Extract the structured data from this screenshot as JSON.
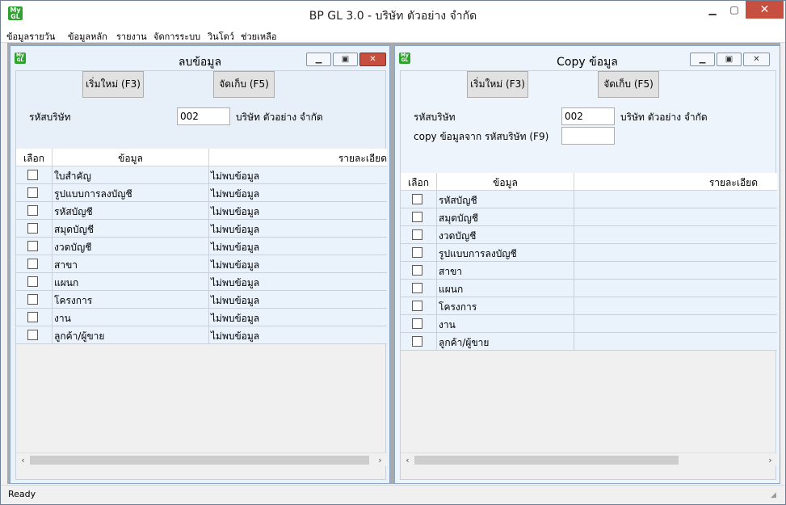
{
  "app": {
    "logo_top": "My",
    "logo_bottom": "GL",
    "title": "BP GL 3.0 - บริษัท ตัวอย่าง จำกัด",
    "min_icon": "minimize-icon",
    "max_icon": "maximize-icon",
    "close_icon": "close-icon"
  },
  "menu": [
    "ข้อมูลรายวัน",
    "ข้อมูลหลัก",
    "รายงาน",
    "จัดการระบบ",
    "วินโดว์",
    "ช่วยเหลือ"
  ],
  "left": {
    "title": "ลบข้อมูล",
    "new_button": "เริ่มใหม่ (F3)",
    "save_button": "จัดเก็บ (F5)",
    "company_label": "รหัสบริษัท",
    "company_code": "002",
    "company_name": "บริษัท ตัวอย่าง จำกัด",
    "headers": [
      "เลือก",
      "ข้อมูล",
      "รายละเอียด"
    ],
    "rows": [
      {
        "name": "ใบสำคัญ",
        "detail": "ไม่พบข้อมูล"
      },
      {
        "name": "รูปแบบการลงบัญชี",
        "detail": "ไม่พบข้อมูล"
      },
      {
        "name": "รหัสบัญชี",
        "detail": "ไม่พบข้อมูล"
      },
      {
        "name": "สมุดบัญชี",
        "detail": "ไม่พบข้อมูล"
      },
      {
        "name": "งวดบัญชี",
        "detail": "ไม่พบข้อมูล"
      },
      {
        "name": "สาขา",
        "detail": "ไม่พบข้อมูล"
      },
      {
        "name": "แผนก",
        "detail": "ไม่พบข้อมูล"
      },
      {
        "name": "โครงการ",
        "detail": "ไม่พบข้อมูล"
      },
      {
        "name": "งาน",
        "detail": "ไม่พบข้อมูล"
      },
      {
        "name": "ลูกค้า/ผู้ขาย",
        "detail": "ไม่พบข้อมูล"
      }
    ]
  },
  "right": {
    "title": "Copy ข้อมูล",
    "new_button": "เริ่มใหม่ (F3)",
    "save_button": "จัดเก็บ (F5)",
    "company_label": "รหัสบริษัท",
    "company_code": "002",
    "company_name": "บริษัท ตัวอย่าง จำกัด",
    "copy_label": "copy ข้อมูลจาก รหัสบริษัท (F9)",
    "copy_value": "",
    "headers": [
      "เลือก",
      "ข้อมูล",
      "รายละเอียด"
    ],
    "rows": [
      {
        "name": "รหัสบัญชี",
        "detail": ""
      },
      {
        "name": "สมุดบัญชี",
        "detail": ""
      },
      {
        "name": "งวดบัญชี",
        "detail": ""
      },
      {
        "name": "รูปแบบการลงบัญชี",
        "detail": ""
      },
      {
        "name": "สาขา",
        "detail": ""
      },
      {
        "name": "แผนก",
        "detail": ""
      },
      {
        "name": "โครงการ",
        "detail": ""
      },
      {
        "name": "งาน",
        "detail": ""
      },
      {
        "name": "ลูกค้า/ผู้ขาย",
        "detail": ""
      }
    ]
  },
  "status": {
    "text": "Ready"
  }
}
